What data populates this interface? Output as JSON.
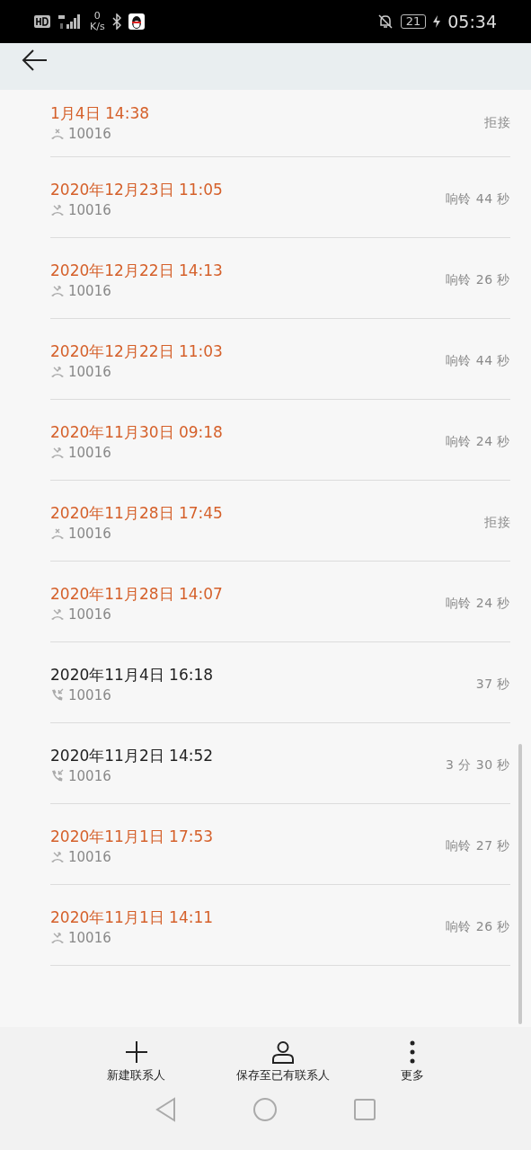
{
  "status_bar": {
    "speed_value": "0",
    "speed_unit": "K/s",
    "battery": "21",
    "time": "05:34"
  },
  "calls": [
    {
      "kind": "rejected",
      "datetime": "1月4日 14:38",
      "number": "10016",
      "detail": "拒接"
    },
    {
      "kind": "missed",
      "datetime": "2020年12月23日 11:05",
      "number": "10016",
      "detail": "响铃 44 秒"
    },
    {
      "kind": "missed",
      "datetime": "2020年12月22日 14:13",
      "number": "10016",
      "detail": "响铃 26 秒"
    },
    {
      "kind": "missed",
      "datetime": "2020年12月22日 11:03",
      "number": "10016",
      "detail": "响铃 44 秒"
    },
    {
      "kind": "missed",
      "datetime": "2020年11月30日 09:18",
      "number": "10016",
      "detail": "响铃 24 秒"
    },
    {
      "kind": "rejected",
      "datetime": "2020年11月28日 17:45",
      "number": "10016",
      "detail": "拒接"
    },
    {
      "kind": "missed",
      "datetime": "2020年11月28日 14:07",
      "number": "10016",
      "detail": "响铃 24 秒"
    },
    {
      "kind": "incoming",
      "datetime": "2020年11月4日 16:18",
      "number": "10016",
      "detail": "37 秒"
    },
    {
      "kind": "incoming",
      "datetime": "2020年11月2日 14:52",
      "number": "10016",
      "detail": "3 分 30 秒"
    },
    {
      "kind": "missed",
      "datetime": "2020年11月1日 17:53",
      "number": "10016",
      "detail": "响铃 27 秒"
    },
    {
      "kind": "missed",
      "datetime": "2020年11月1日 14:11",
      "number": "10016",
      "detail": "响铃 26 秒"
    }
  ],
  "actions": [
    {
      "kind": "add",
      "label": "新建联系人"
    },
    {
      "kind": "person",
      "label": "保存至已有联系人"
    },
    {
      "kind": "more",
      "label": "更多"
    }
  ]
}
